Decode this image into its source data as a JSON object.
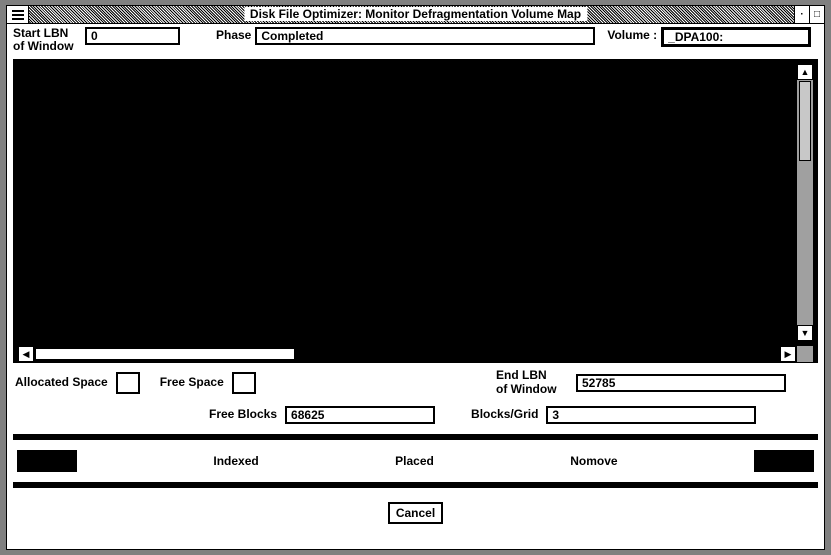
{
  "title": "Disk File Optimizer: Monitor Defragmentation Volume Map",
  "header": {
    "start_lbn_label": "Start LBN\nof Window",
    "start_lbn_value": "0",
    "phase_label": "Phase",
    "phase_value": "Completed",
    "volume_label": "Volume :",
    "volume_value": "_DPA100:"
  },
  "legend": {
    "allocated_label": "Allocated Space",
    "free_space_label": "Free Space",
    "end_lbn_label": "End LBN\nof Window",
    "end_lbn_value": "52785",
    "free_blocks_label": "Free Blocks",
    "free_blocks_value": "68625",
    "blocks_grid_label": "Blocks/Grid",
    "blocks_grid_value": "3"
  },
  "status": {
    "indexed": "Indexed",
    "placed": "Placed",
    "nomove": "Nomove"
  },
  "buttons": {
    "cancel": "Cancel"
  },
  "titlebar_controls": {
    "min_icon": "minimize-icon",
    "max_icon": "maximize-icon"
  }
}
